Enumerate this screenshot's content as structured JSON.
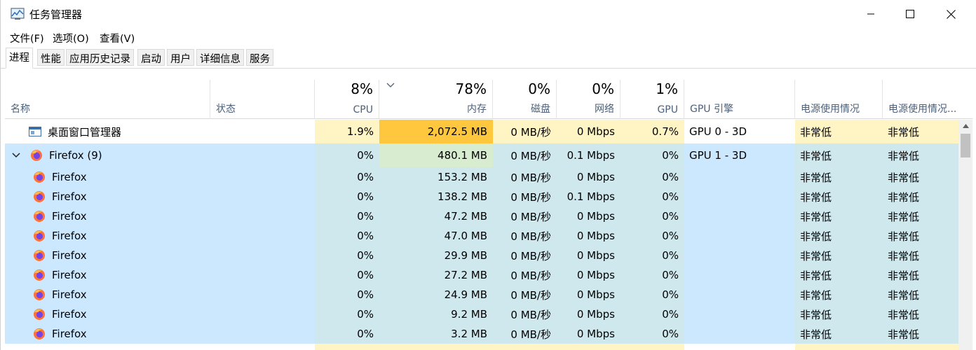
{
  "window": {
    "title": "任务管理器"
  },
  "menu": [
    "文件(F)",
    "选项(O)",
    "查看(V)"
  ],
  "tabs": [
    "进程",
    "性能",
    "应用历史记录",
    "启动",
    "用户",
    "详细信息",
    "服务"
  ],
  "active_tab": 0,
  "columns": {
    "name": {
      "label": "名称"
    },
    "status": {
      "label": "状态"
    },
    "cpu": {
      "pct": "8%",
      "label": "CPU"
    },
    "mem": {
      "pct": "78%",
      "label": "内存"
    },
    "disk": {
      "pct": "0%",
      "label": "磁盘"
    },
    "net": {
      "pct": "0%",
      "label": "网络"
    },
    "gpu": {
      "pct": "1%",
      "label": "GPU"
    },
    "gpu_engine": {
      "label": "GPU 引擎"
    },
    "power": {
      "label": "电源使用情况"
    },
    "power_trend": {
      "label": "电源使用情况..."
    }
  },
  "colors": {
    "heat_light": "#fff4c4",
    "heat_strong": "#ffc73d",
    "selection": "#cce8ff",
    "firefox_orange": "#ff7139"
  },
  "rows": [
    {
      "name": "桌面窗口管理器",
      "icon": "dwm-window-icon",
      "expand": "",
      "cpu": "1.9%",
      "mem": "2,072.5 MB",
      "disk": "0 MB/秒",
      "net": "0 Mbps",
      "gpu": "0.7%",
      "gpu_engine": "GPU 0 - 3D",
      "power": "非常低",
      "power_trend": "非常低"
    },
    {
      "name": "Firefox (9)",
      "icon": "firefox-icon",
      "expand": "collapse",
      "cpu": "0%",
      "mem": "480.1 MB",
      "disk": "0 MB/秒",
      "net": "0.1 Mbps",
      "gpu": "0%",
      "gpu_engine": "GPU 1 - 3D",
      "power": "非常低",
      "power_trend": "非常低"
    },
    {
      "name": "Firefox",
      "icon": "firefox-icon",
      "expand": "",
      "cpu": "0%",
      "mem": "153.2 MB",
      "disk": "0 MB/秒",
      "net": "0 Mbps",
      "gpu": "0%",
      "gpu_engine": "",
      "power": "非常低",
      "power_trend": "非常低"
    },
    {
      "name": "Firefox",
      "icon": "firefox-icon",
      "expand": "",
      "cpu": "0%",
      "mem": "138.2 MB",
      "disk": "0 MB/秒",
      "net": "0.1 Mbps",
      "gpu": "0%",
      "gpu_engine": "",
      "power": "非常低",
      "power_trend": "非常低"
    },
    {
      "name": "Firefox",
      "icon": "firefox-icon",
      "expand": "",
      "cpu": "0%",
      "mem": "47.2 MB",
      "disk": "0 MB/秒",
      "net": "0 Mbps",
      "gpu": "0%",
      "gpu_engine": "",
      "power": "非常低",
      "power_trend": "非常低"
    },
    {
      "name": "Firefox",
      "icon": "firefox-icon",
      "expand": "",
      "cpu": "0%",
      "mem": "47.0 MB",
      "disk": "0 MB/秒",
      "net": "0 Mbps",
      "gpu": "0%",
      "gpu_engine": "",
      "power": "非常低",
      "power_trend": "非常低"
    },
    {
      "name": "Firefox",
      "icon": "firefox-icon",
      "expand": "",
      "cpu": "0%",
      "mem": "29.9 MB",
      "disk": "0 MB/秒",
      "net": "0 Mbps",
      "gpu": "0%",
      "gpu_engine": "",
      "power": "非常低",
      "power_trend": "非常低"
    },
    {
      "name": "Firefox",
      "icon": "firefox-icon",
      "expand": "",
      "cpu": "0%",
      "mem": "27.2 MB",
      "disk": "0 MB/秒",
      "net": "0 Mbps",
      "gpu": "0%",
      "gpu_engine": "",
      "power": "非常低",
      "power_trend": "非常低"
    },
    {
      "name": "Firefox",
      "icon": "firefox-icon",
      "expand": "",
      "cpu": "0%",
      "mem": "24.9 MB",
      "disk": "0 MB/秒",
      "net": "0 Mbps",
      "gpu": "0%",
      "gpu_engine": "",
      "power": "非常低",
      "power_trend": "非常低"
    },
    {
      "name": "Firefox",
      "icon": "firefox-icon",
      "expand": "",
      "cpu": "0%",
      "mem": "9.2 MB",
      "disk": "0 MB/秒",
      "net": "0 Mbps",
      "gpu": "0%",
      "gpu_engine": "",
      "power": "非常低",
      "power_trend": "非常低"
    },
    {
      "name": "Firefox",
      "icon": "firefox-icon",
      "expand": "",
      "cpu": "0%",
      "mem": "3.2 MB",
      "disk": "0 MB/秒",
      "net": "0 Mbps",
      "gpu": "0%",
      "gpu_engine": "",
      "power": "非常低",
      "power_trend": "非常低"
    }
  ]
}
